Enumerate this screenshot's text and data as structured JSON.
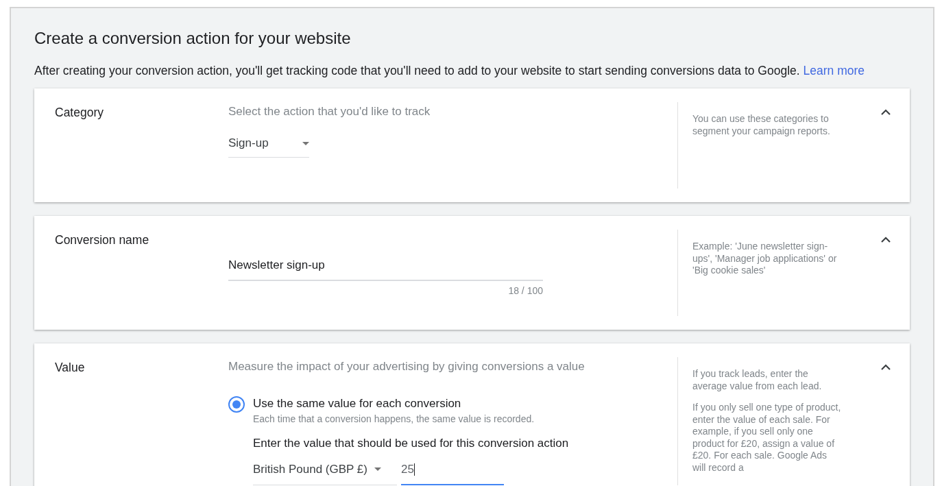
{
  "title": "Create a conversion action for your website",
  "intro": {
    "text": "After creating your conversion action, you'll get tracking code that you'll need to add to your website to start sending conversions data to Google.",
    "link": "Learn more"
  },
  "sections": [
    {
      "kind": "select",
      "label": "Category",
      "prompt": "Select the action that you'd like to track",
      "value": "Sign-up",
      "expanded": true,
      "help": [
        "You can use these categories to segment your campaign reports."
      ]
    },
    {
      "kind": "text",
      "label": "Conversion name",
      "value": "Newsletter sign-up",
      "counter": "18 / 100",
      "expanded": true,
      "help": [
        "Example: 'June newsletter sign-ups', 'Manager job applications' or 'Big cookie sales'"
      ]
    },
    {
      "kind": "value",
      "label": "Value",
      "prompt": "Measure the impact of your advertising by giving conversions a value",
      "options": [
        {
          "label": "Use the same value for each conversion",
          "hint": "Each time that a conversion happens, the same value is recorded.",
          "selected": true
        }
      ],
      "entry_label": "Enter the value that should be used for this conversion action",
      "currency": "British Pound (GBP £)",
      "amount": "25",
      "expanded": true,
      "help": [
        "If you track leads, enter the average value from each lead.",
        "If you only sell one type of product, enter the value of each sale. For example, if you sell only one product for £20, assign a value of £20. For each sale. Google Ads will record a"
      ]
    }
  ]
}
